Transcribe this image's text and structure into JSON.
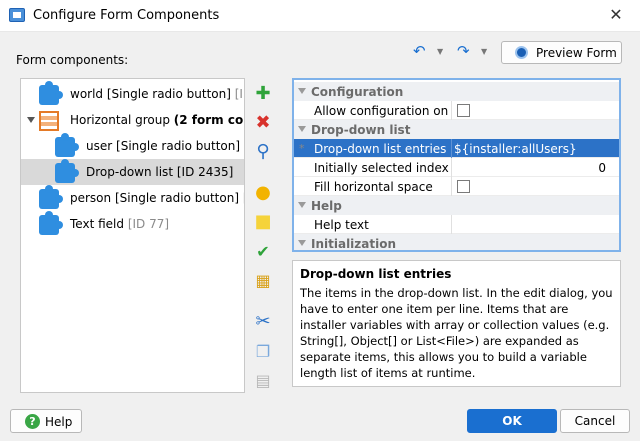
{
  "window": {
    "title": "Configure Form Components",
    "close_glyph": "✕"
  },
  "components_label": "Form components:",
  "toolbar": {
    "undo_glyph": "↶",
    "redo_glyph": "↷",
    "dropdown_glyph": "▼",
    "preview_label": "Preview Form"
  },
  "tree": {
    "items": [
      {
        "name": "world",
        "kind": "[Single radio button]",
        "id": "[ID ..."
      },
      {
        "name": "Horizontal group",
        "bold_suffix": "(2 form com...",
        "kind": "",
        "id": ""
      },
      {
        "name": "user",
        "kind": "[Single radio button]",
        "id": "[I..."
      },
      {
        "name": "Drop-down list",
        "kind": "[ID 2435]",
        "id": ""
      },
      {
        "name": "person",
        "kind": "[Single radio button]",
        "id": "[I..."
      },
      {
        "name": "Text field",
        "kind": "",
        "id": "[ID 77]"
      }
    ]
  },
  "side_toolbar": {
    "add_glyph": "✚",
    "delete_glyph": "✖",
    "search_glyph": "⚲",
    "comment_glyph": "●",
    "note_glyph": "■",
    "check_glyph": "✔",
    "folder_glyph": "▦",
    "cut_glyph": "✂",
    "copy_glyph": "❐",
    "paste_glyph": "▤"
  },
  "properties": {
    "categories": [
      "Configuration",
      "Drop-down list",
      "Help",
      "Initialization"
    ],
    "rows": {
      "allow_config": {
        "name": "Allow configuration on ..."
      },
      "entries": {
        "name": "Drop-down list entries",
        "value": "${installer:allUsers}",
        "marker": "*"
      },
      "selected_index": {
        "name": "Initially selected index",
        "value": "0"
      },
      "fill_space": {
        "name": "Fill horizontal space"
      },
      "help_text": {
        "name": "Help text",
        "value": ""
      }
    }
  },
  "description": {
    "title": "Drop-down list entries",
    "body": "The items in the drop-down list. In the edit dialog, you have to enter one item per line. Items that are installer variables with array or collection values (e.g. String[], Object[] or List<File>) are expanded as separate items, this allows you to build a variable length list of items at runtime."
  },
  "buttons": {
    "help": "Help",
    "help_glyph": "?",
    "ok": "OK",
    "cancel": "Cancel"
  },
  "colors": {
    "accent": "#1a6fd0",
    "selection": "#2c72c7",
    "add_green": "#2fa33a",
    "delete_red": "#d8322c"
  }
}
